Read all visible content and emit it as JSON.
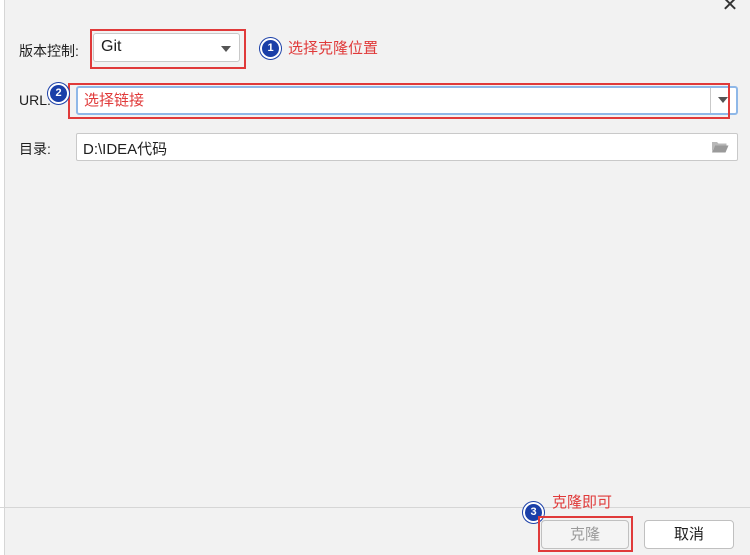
{
  "window": {
    "close_label": "✕"
  },
  "form": {
    "vcs_label": "版本控制:",
    "vcs_value": "Git",
    "url_label": "URL:",
    "url_value": "",
    "dir_label": "目录:",
    "dir_value": "D:\\IDEA代码"
  },
  "annotations": {
    "step1_number": "1",
    "step1_text": "选择克隆位置",
    "step2_number": "2",
    "step2_text": "选择链接",
    "step3_number": "3",
    "step3_text": "克隆即可"
  },
  "buttons": {
    "clone_label": "克隆",
    "cancel_label": "取消"
  },
  "icons": [
    "chevron-down-icon",
    "folder-open-icon",
    "close-icon"
  ],
  "colors": {
    "annotation_red": "#e03a3a",
    "badge_blue": "#1a3fa8",
    "focus_blue": "#8fb8e8"
  }
}
